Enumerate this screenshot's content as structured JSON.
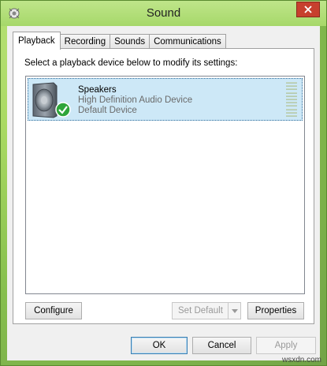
{
  "window": {
    "title": "Sound"
  },
  "tabs": [
    {
      "label": "Playback",
      "active": true
    },
    {
      "label": "Recording",
      "active": false
    },
    {
      "label": "Sounds",
      "active": false
    },
    {
      "label": "Communications",
      "active": false
    }
  ],
  "playback": {
    "instruction": "Select a playback device below to modify its settings:",
    "devices": [
      {
        "name": "Speakers",
        "description": "High Definition Audio Device",
        "status": "Default Device",
        "icon": "speaker-icon",
        "badge_icon": "checkmark-icon"
      }
    ],
    "buttons": {
      "configure": "Configure",
      "set_default": "Set Default",
      "properties": "Properties"
    }
  },
  "dialog_buttons": {
    "ok": "OK",
    "cancel": "Cancel",
    "apply": "Apply"
  },
  "watermark": "wsxdn.com",
  "colors": {
    "selection": "#cde8f7",
    "close_button": "#c7402e",
    "check_green": "#2ea53a"
  }
}
